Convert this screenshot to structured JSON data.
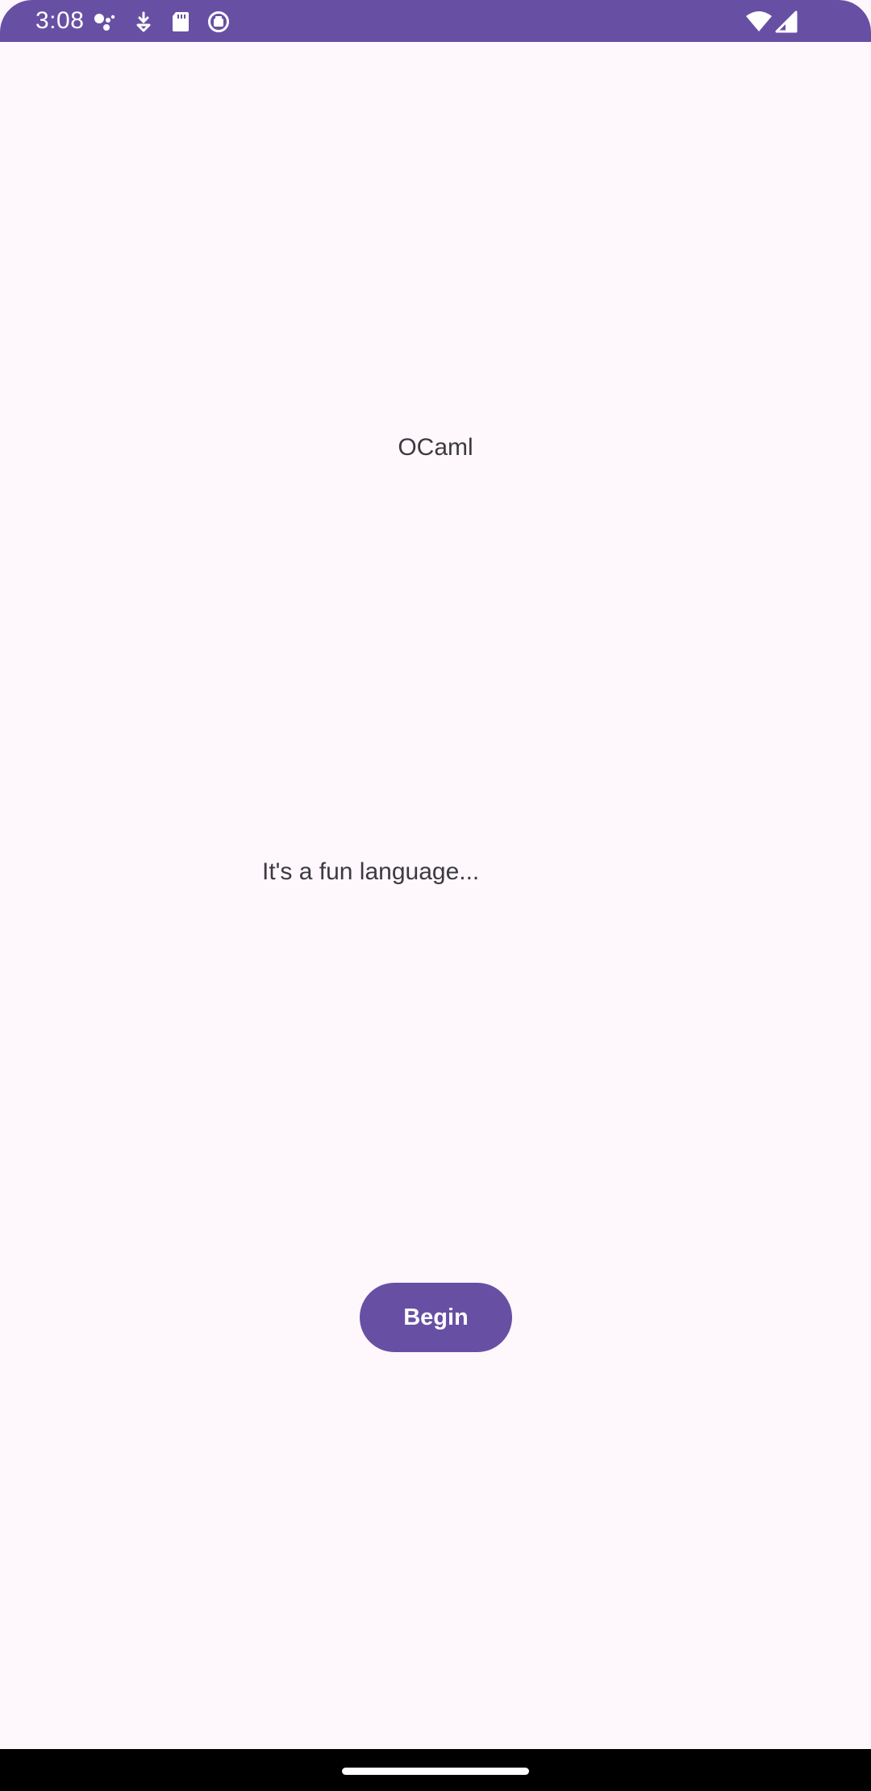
{
  "status_bar": {
    "time": "3:08",
    "background_color": "#6750a4",
    "icons": [
      "assistant-icon",
      "download-icon",
      "sd-card-icon",
      "recording-icon",
      "wifi-icon",
      "cell-signal-icon"
    ]
  },
  "main": {
    "title": "OCaml",
    "subtitle": "It's a fun language...",
    "begin_button_label": "Begin"
  },
  "colors": {
    "accent": "#6750a4",
    "background": "#fef7fc",
    "text": "#3c3a40"
  }
}
